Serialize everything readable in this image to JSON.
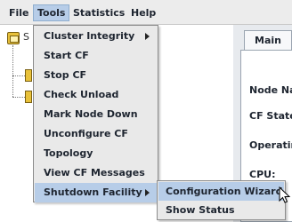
{
  "menubar": {
    "items": [
      {
        "label": "File"
      },
      {
        "label": "Tools"
      },
      {
        "label": "Statistics"
      },
      {
        "label": "Help"
      }
    ],
    "active": "Tools"
  },
  "tree": {
    "root_label": "S"
  },
  "right_panel": {
    "tab": "Main",
    "labels": [
      "Node Na",
      "CF State",
      "Operatin",
      "CPU:"
    ]
  },
  "tools_menu": {
    "items": [
      {
        "label": "Cluster Integrity",
        "submenu": true
      },
      {
        "label": "Start CF"
      },
      {
        "label": "Stop CF"
      },
      {
        "label": "Check Unload"
      },
      {
        "label": "Mark Node Down"
      },
      {
        "label": "Unconfigure CF"
      },
      {
        "label": "Topology"
      },
      {
        "label": "View CF Messages"
      },
      {
        "label": "Shutdown Facility",
        "submenu": true,
        "highlighted": true
      }
    ]
  },
  "shutdown_submenu": {
    "items": [
      {
        "label": "Configuration Wizard",
        "highlighted": true
      },
      {
        "label": "Show Status"
      }
    ]
  },
  "colors": {
    "menu_bg": "#e9e9e9",
    "highlight": "#b7cde8",
    "menubar_bg": "#ececec",
    "panel_bg": "#e7eaee"
  }
}
